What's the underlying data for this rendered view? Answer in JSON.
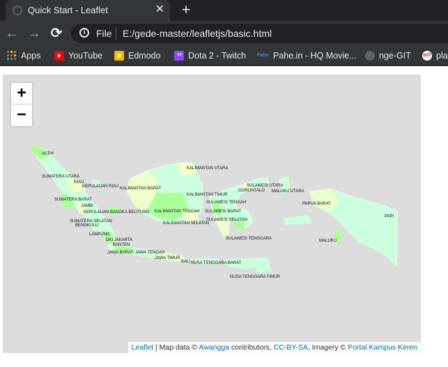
{
  "tab": {
    "title": "Quick Start - Leaflet",
    "close": "✕",
    "new_tab": "+"
  },
  "toolbar": {
    "back": "←",
    "forward": "→",
    "reload": "⟳",
    "info": "i",
    "scheme": "File",
    "url": "E:/gede-master/leafletjs/basic.html"
  },
  "bookmarks": [
    {
      "label": "Apps",
      "icon": "apps-grid-icon"
    },
    {
      "label": "YouTube",
      "icon": "youtube-icon",
      "color": "#ff0000"
    },
    {
      "label": "Edmodo",
      "icon": "edmodo-icon",
      "color": "#f5b800"
    },
    {
      "label": "Dota 2 - Twitch",
      "icon": "twitch-icon",
      "color": "#9146ff"
    },
    {
      "label": "Pahe.in - HQ Movie...",
      "icon": "pahe-icon",
      "color": "#1e3a8a"
    },
    {
      "label": "nge-GIT",
      "icon": "github-icon"
    },
    {
      "label": "pla",
      "icon": "sst-icon"
    }
  ],
  "bookmark_icon_text": {
    "edmodo": "e",
    "pahe": "Pahe",
    "sst": "SST"
  },
  "map": {
    "zoom_in": "+",
    "zoom_out": "−",
    "colors": {
      "land_light": "#ccffdd",
      "land_green": "#aaff99",
      "land_yellow": "#eeffcc",
      "background": "#dddddd"
    },
    "provinces": {
      "aceh": "ACEH",
      "sumut": "SUMATERA UTARA",
      "riau": "RIAU",
      "kepri": "KEPULAUAN RIAU",
      "kalbar": "KALIMANTAN BARAT",
      "kalut": "KALIMANTAN UTARA",
      "kaltim": "KALIMANTAN TIMUR",
      "sulut": "SULAWESI UTARA",
      "gorontalo": "GORONTALO",
      "malut": "MALUKU UTARA",
      "sumbar": "SUMATERA BARAT",
      "jambi": "JAMBI",
      "babel": "KEPULAUAN BANGKA BELITUNG",
      "kalteng": "KALIMANTAN TENGAH",
      "sulteng": "SULAWESI TENGAH",
      "sulbar": "SULAWESI BARAT",
      "papbar": "PAPUA BARAT",
      "sumsel": "SUMATERA SELATAN",
      "bengkulu": "BENGKULU",
      "kalsel": "KALIMANTAN SELATAN",
      "sulsel": "SULAWESI SELATAN",
      "papua": "PAPI",
      "lampung": "LAMPUNG",
      "jakarta": "DKI JAKARTA",
      "banten": "BANTEN",
      "sultra": "SULAWESI TENGGARA",
      "maluku": "MALUKU",
      "jabar": "JAWA BARAT",
      "jateng": "JAWA TENGAH",
      "jatim": "JAWA TIMUR",
      "bali": "BALI",
      "ntb": "NUSA TENGGARA BARAT",
      "ntt": "NUSA TENGGARA TIMUR"
    },
    "attribution": {
      "leaflet": "Leaflet",
      "sep1": " | Map data © ",
      "awangga": "Awangga",
      "sep2": " contributors, ",
      "license": "CC-BY-SA",
      "sep3": ", Imagery © ",
      "portal": "Portal Kampus Keren"
    }
  }
}
